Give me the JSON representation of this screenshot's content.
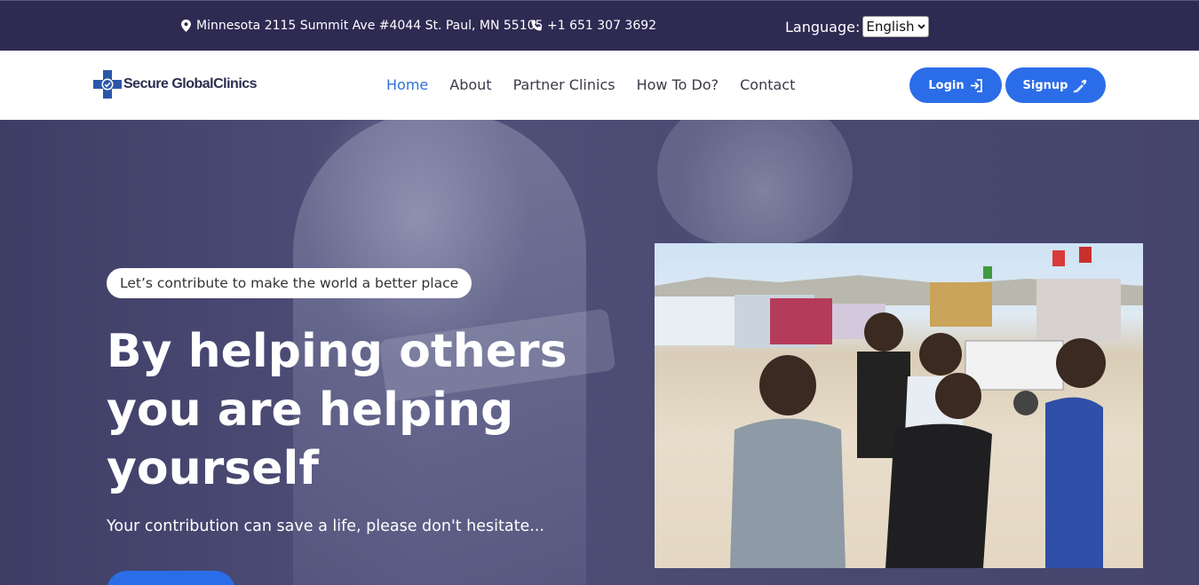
{
  "topbar": {
    "address": "Minnesota 2115 Summit Ave #4044 St. Paul, MN 55105",
    "phone": "+1 651 307 3692",
    "language_label": "Language:",
    "language_selected": "English",
    "icons": [
      "map-pin-icon",
      "phone-icon",
      "chevron-down-icon"
    ]
  },
  "navbar": {
    "logo_text": "Secure GlobalClinics",
    "links": [
      {
        "label": "Home",
        "active": true
      },
      {
        "label": "About"
      },
      {
        "label": "Partner Clinics"
      },
      {
        "label": "How To Do?"
      },
      {
        "label": "Contact"
      }
    ],
    "login_label": "Login",
    "signup_label": "Signup",
    "icons": [
      "login-arrow-icon",
      "syringe-icon"
    ]
  },
  "hero": {
    "tagline": "Let’s contribute to make the world a better place",
    "headline": "By helping others you are helping yourself",
    "subtitle": "Your contribution can save a life, please don't hesitate..."
  },
  "colors": {
    "topbar_bg": "#2e2a52",
    "accent": "#2b6de8",
    "active_link": "#2f6fd8",
    "hero_overlay": "#45446c"
  }
}
